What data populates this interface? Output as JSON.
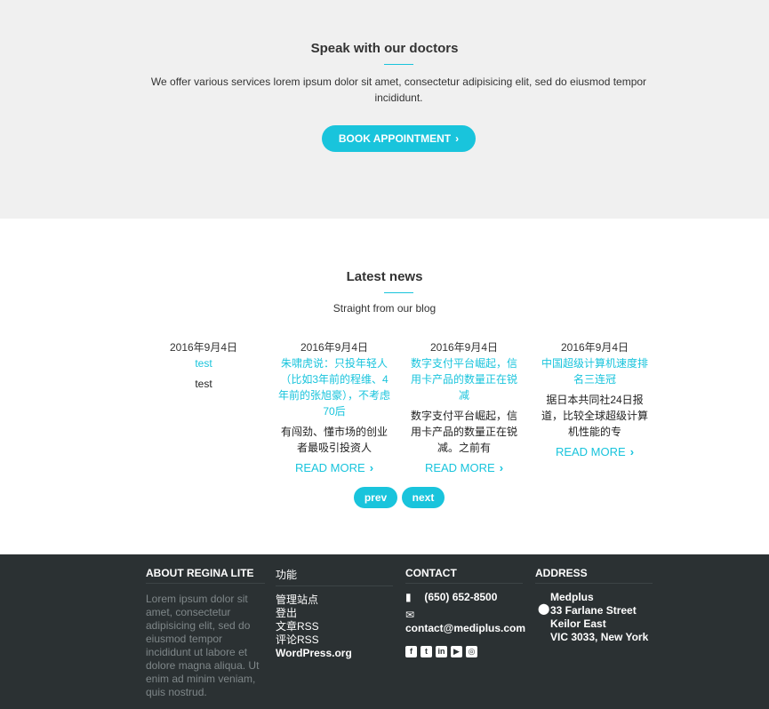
{
  "cta": {
    "title": "Speak with our doctors",
    "text": "We offer various services lorem ipsum dolor sit amet, consectetur adipisicing elit, sed do eiusmod tempor incididunt.",
    "button_label": "BOOK APPOINTMENT"
  },
  "news": {
    "title": "Latest news",
    "subtitle": "Straight from our blog",
    "posts": [
      {
        "date": "2016年9月4日",
        "title": "test",
        "excerpt": "test",
        "more": ""
      },
      {
        "date": "2016年9月4日",
        "title": "朱啸虎说：只投年轻人（比如3年前的程维、4年前的张旭豪），不考虑70后",
        "excerpt": "有闯劲、懂市场的创业者最吸引投资人",
        "more": "READ MORE"
      },
      {
        "date": "2016年9月4日",
        "title": "数字支付平台崛起，信用卡产品的数量正在锐减",
        "excerpt": "数字支付平台崛起，信用卡产品的数量正在锐减。之前有",
        "more": "READ MORE"
      },
      {
        "date": "2016年9月4日",
        "title": "中国超级计算机速度排名三连冠",
        "excerpt": "据日本共同社24日报道，比较全球超级计算机性能的专",
        "more": "READ MORE"
      }
    ],
    "prev_label": "prev",
    "next_label": "next"
  },
  "footer": {
    "about": {
      "heading": "ABOUT REGINA LITE",
      "text": "Lorem ipsum dolor sit amet, consectetur adipisicing elit, sed do eiusmod tempor incididunt ut labore et dolore magna aliqua. Ut enim ad minim veniam, quis nostrud."
    },
    "functions": {
      "heading": "功能",
      "links": [
        "管理站点",
        "登出",
        "文章RSS",
        "评论RSS",
        "WordPress.org"
      ]
    },
    "contact": {
      "heading": "CONTACT",
      "phone": "(650) 652-8500",
      "email": "contact@mediplus.com",
      "social_icons": [
        "facebook-icon",
        "twitter-icon",
        "linkedin-icon",
        "youtube-icon",
        "instagram-icon"
      ]
    },
    "address": {
      "heading": "ADDRESS",
      "lines": [
        "Medplus",
        "33 Farlane Street",
        "Keilor East",
        "VIC 3033, New York"
      ]
    }
  },
  "colors": {
    "accent": "#19c4dc",
    "cta_bg": "#f0f0f0",
    "footer_bg": "#2b3133",
    "footer_muted": "#7f8789"
  }
}
